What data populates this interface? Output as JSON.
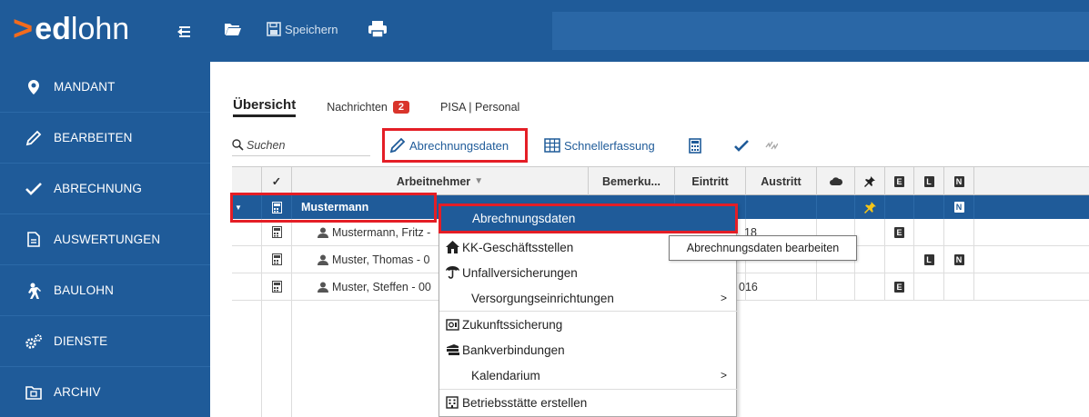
{
  "app": {
    "brand_ed": "ed",
    "brand_lohn": "lohn"
  },
  "toolbar_top": {
    "save_label": "Speichern"
  },
  "sidebar": {
    "items": [
      {
        "label": "MANDANT",
        "icon": "map-pin-icon"
      },
      {
        "label": "BEARBEITEN",
        "icon": "pencil-icon"
      },
      {
        "label": "ABRECHNUNG",
        "icon": "check-icon"
      },
      {
        "label": "AUSWERTUNGEN",
        "icon": "document-icon"
      },
      {
        "label": "BAULOHN",
        "icon": "worker-icon"
      },
      {
        "label": "DIENSTE",
        "icon": "gears-icon"
      },
      {
        "label": "ARCHIV",
        "icon": "archive-folder-icon"
      }
    ]
  },
  "tabs": [
    {
      "label": "Übersicht",
      "active": true
    },
    {
      "label": "Nachrichten",
      "badge": "2"
    },
    {
      "label": "PISA | Personal"
    }
  ],
  "toolbar": {
    "search_placeholder": "Suchen",
    "abrechnungsdaten": "Abrechnungsdaten",
    "schnellerfassung": "Schnellerfassung"
  },
  "table": {
    "headers": {
      "check": "✓",
      "arbeitnehmer": "Arbeitnehmer",
      "bemerkung": "Bemerku...",
      "eintritt": "Eintritt",
      "austritt": "Austritt",
      "e": "E",
      "l": "L",
      "n": "N"
    },
    "group": {
      "name": "Mustermann",
      "n": "N"
    },
    "rows": [
      {
        "name": "Mustermann, Fritz -",
        "eintritt_tail": "18",
        "e": "E",
        "l": "",
        "n": ""
      },
      {
        "name": "Muster, Thomas - 0",
        "eintritt_tail": "",
        "e": "",
        "l": "L",
        "n": "N"
      },
      {
        "name": "Muster, Steffen - 00",
        "eintritt_tail": "016",
        "e": "E",
        "l": "",
        "n": ""
      }
    ]
  },
  "context_menu": {
    "items": [
      {
        "label": "Abrechnungsdaten",
        "hover": true
      },
      {
        "label": "KK-Geschäftsstellen",
        "icon": "house-icon"
      },
      {
        "label": "Unfallversicherungen",
        "icon": "umbrella-icon"
      },
      {
        "label": "Versorgungseinrichtungen",
        "submenu": ">"
      },
      {
        "label": "Zukunftssicherung",
        "icon": "safe-icon"
      },
      {
        "label": "Bankverbindungen",
        "icon": "bank-icon"
      },
      {
        "label": "Kalendarium",
        "submenu": ">"
      },
      {
        "label": "Betriebsstätte erstellen",
        "icon": "building-icon"
      }
    ]
  },
  "tooltip": "Abrechnungsdaten bearbeiten",
  "colors": {
    "brand_blue": "#1f5b99",
    "accent_orange": "#f26b1d",
    "highlight_red": "#e41e26",
    "badge_red": "#d9342b"
  }
}
